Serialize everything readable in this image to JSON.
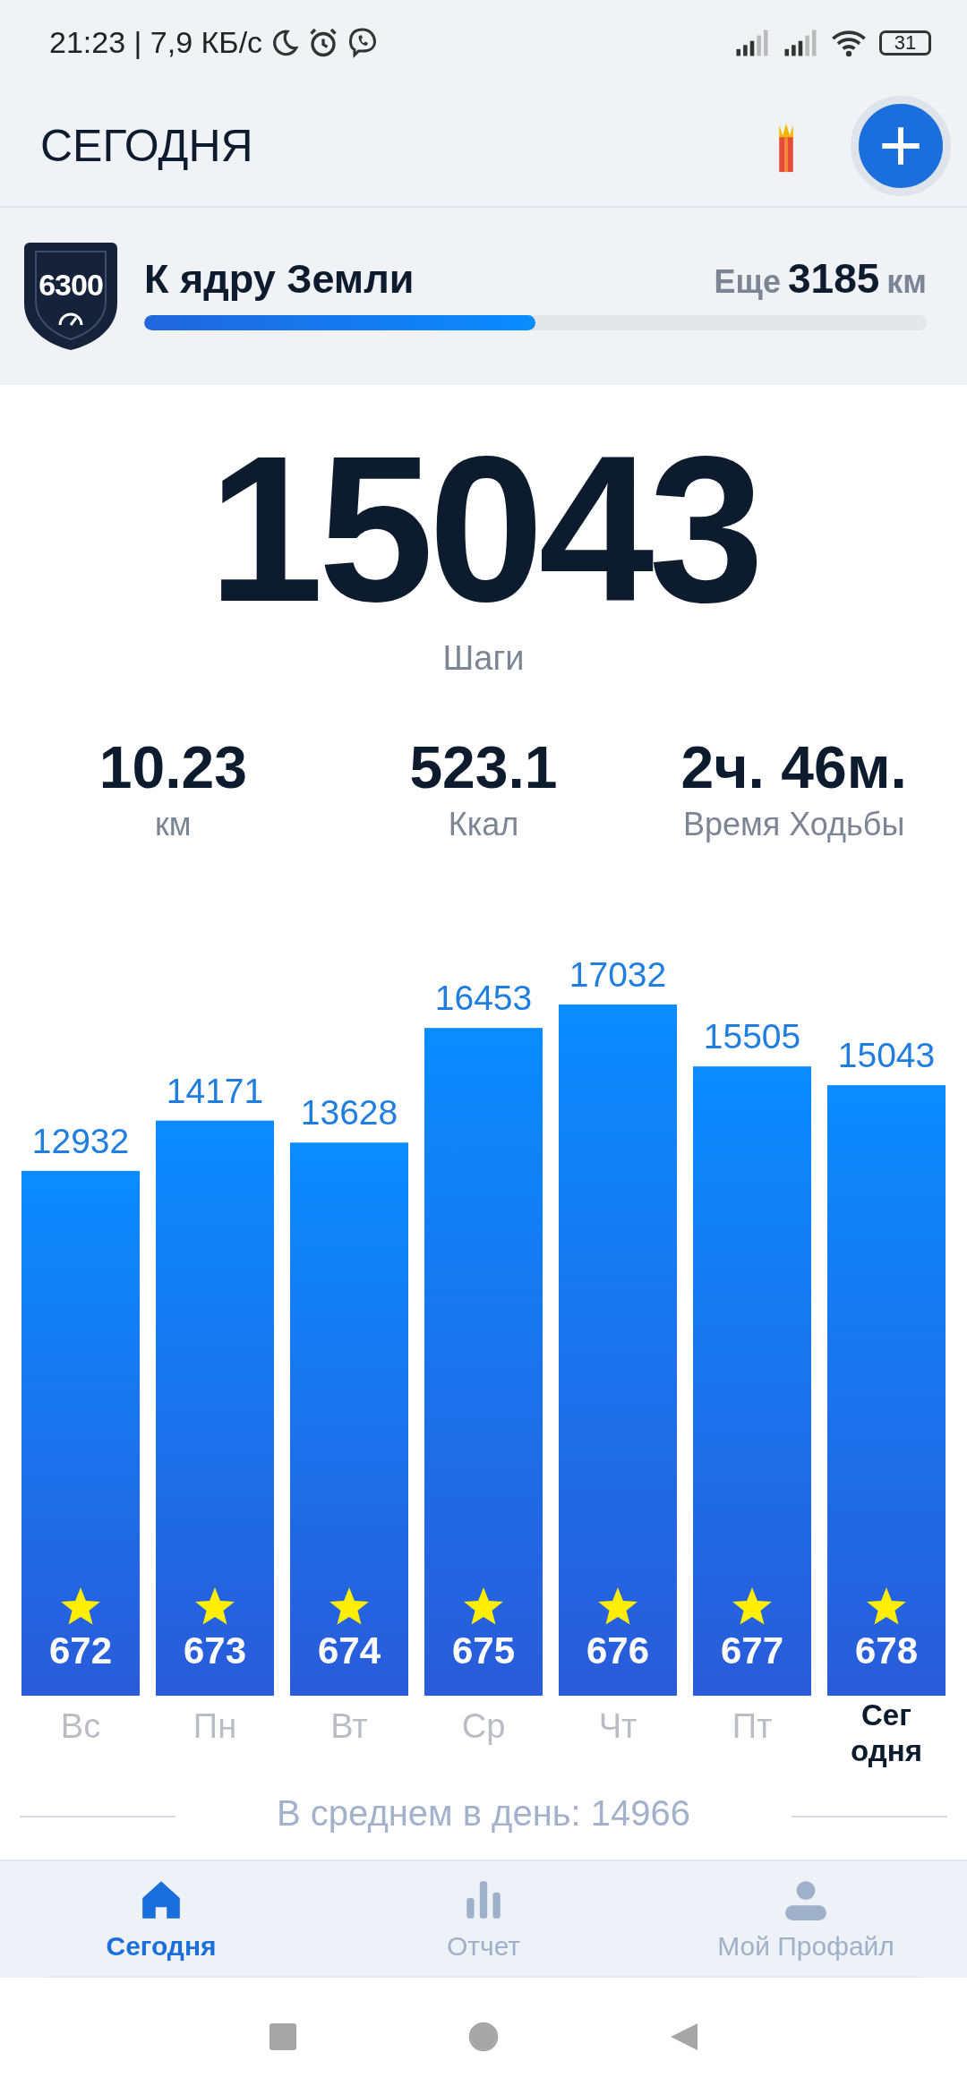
{
  "status_bar": {
    "time_speed": "21:23 | 7,9 КБ/с",
    "battery": "31"
  },
  "header": {
    "title": "СЕГОДНЯ"
  },
  "goal": {
    "badge": "6300",
    "title": "К ядру Земли",
    "remaining_label": "Еще",
    "remaining_value": "3185",
    "remaining_unit": "км",
    "level": 0.5
  },
  "summary": {
    "steps": "15043",
    "steps_label": "Шаги",
    "stats": [
      {
        "value": "10.23",
        "label": "км"
      },
      {
        "value": "523.1",
        "label": "Ккал"
      },
      {
        "value": "2ч. 46м.",
        "label": "Время Ходьбы"
      }
    ]
  },
  "chart": {
    "chart_data": {
      "type": "bar",
      "categories": [
        "Вс",
        "Пн",
        "Вт",
        "Ср",
        "Чт",
        "Пт",
        "Сег одня"
      ],
      "values": [
        12932,
        14171,
        13628,
        16453,
        17032,
        15505,
        15043
      ],
      "data_labels": true
    },
    "days": [
      {
        "badge": "672",
        "selected": false
      },
      {
        "badge": "673",
        "selected": false
      },
      {
        "badge": "674",
        "selected": false
      },
      {
        "badge": "675",
        "selected": false
      },
      {
        "badge": "676",
        "selected": false
      },
      {
        "badge": "677",
        "selected": false
      },
      {
        "badge": "678",
        "selected": true
      }
    ]
  },
  "average": "В среднем в день: 14966",
  "nav": [
    {
      "kind": "home",
      "label": "Сегодня",
      "selected": true
    },
    {
      "kind": "report",
      "label": "Отчет",
      "selected": false
    },
    {
      "kind": "profile",
      "label": "Мой Профайл",
      "selected": false
    }
  ]
}
